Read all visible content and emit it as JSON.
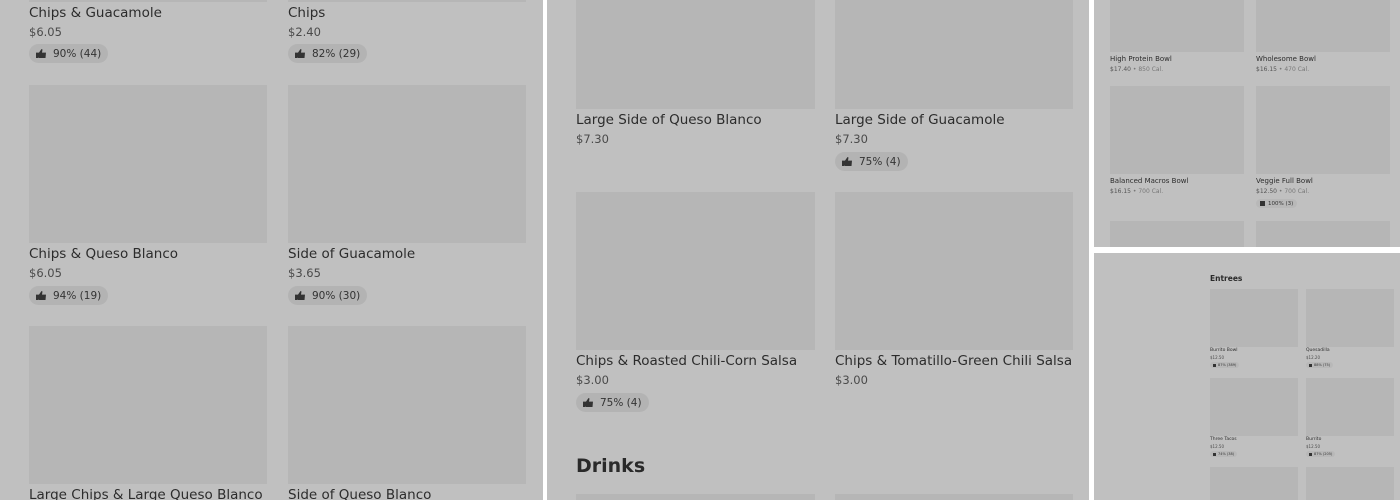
{
  "panel1": {
    "items": [
      {
        "name": "Chips & Guacamole",
        "price": "$6.05",
        "rating": "90% (44)"
      },
      {
        "name": "Chips",
        "price": "$2.40",
        "rating": "82% (29)"
      },
      {
        "name": "Chips & Queso Blanco",
        "price": "$6.05",
        "rating": "94% (19)"
      },
      {
        "name": "Side of Guacamole",
        "price": "$3.65",
        "rating": "90% (30)"
      },
      {
        "name": "Large Chips & Large Queso Blanco",
        "price": "",
        "rating": ""
      },
      {
        "name": "Side of Queso Blanco",
        "price": "",
        "rating": ""
      }
    ]
  },
  "panel2": {
    "items": [
      {
        "name": "Large Side of Queso Blanco",
        "price": "$7.30",
        "rating": ""
      },
      {
        "name": "Large Side of Guacamole",
        "price": "$7.30",
        "rating": "75% (4)"
      },
      {
        "name": "Chips & Roasted Chili-Corn Salsa",
        "price": "$3.00",
        "rating": "75% (4)"
      },
      {
        "name": "Chips & Tomatillo-Green Chili Salsa",
        "price": "$3.00",
        "rating": ""
      }
    ],
    "section_title": "Drinks"
  },
  "panel3": {
    "items": [
      {
        "name": "High Protein Bowl",
        "price": "$17.40",
        "cal": "850 Cal.",
        "rating": ""
      },
      {
        "name": "Wholesome Bowl",
        "price": "$16.15",
        "cal": "470 Cal.",
        "rating": ""
      },
      {
        "name": "Balanced Macros Bowl",
        "price": "$16.15",
        "cal": "700 Cal.",
        "rating": ""
      },
      {
        "name": "Veggie Full Bowl",
        "price": "$12.50",
        "cal": "700 Cal.",
        "rating": "100% (3)"
      }
    ],
    "separator": " • "
  },
  "panel4": {
    "section_title": "Entrees",
    "items": [
      {
        "name": "Burrito Bowl",
        "price": "$12.50",
        "rating": "87% (389)"
      },
      {
        "name": "Quesadilla",
        "price": "$12.20",
        "rating": "88% (75)"
      },
      {
        "name": "Three Tacos",
        "price": "$12.50",
        "rating": "74% (38)"
      },
      {
        "name": "Burrito",
        "price": "$12.50",
        "rating": "87% (205)"
      }
    ]
  },
  "colors": {
    "background": "#c0c0c0",
    "placeholder": "#b6b6b6",
    "badge": "#b3b3b3"
  },
  "icons": {
    "rating": "thumbs-up-icon"
  }
}
